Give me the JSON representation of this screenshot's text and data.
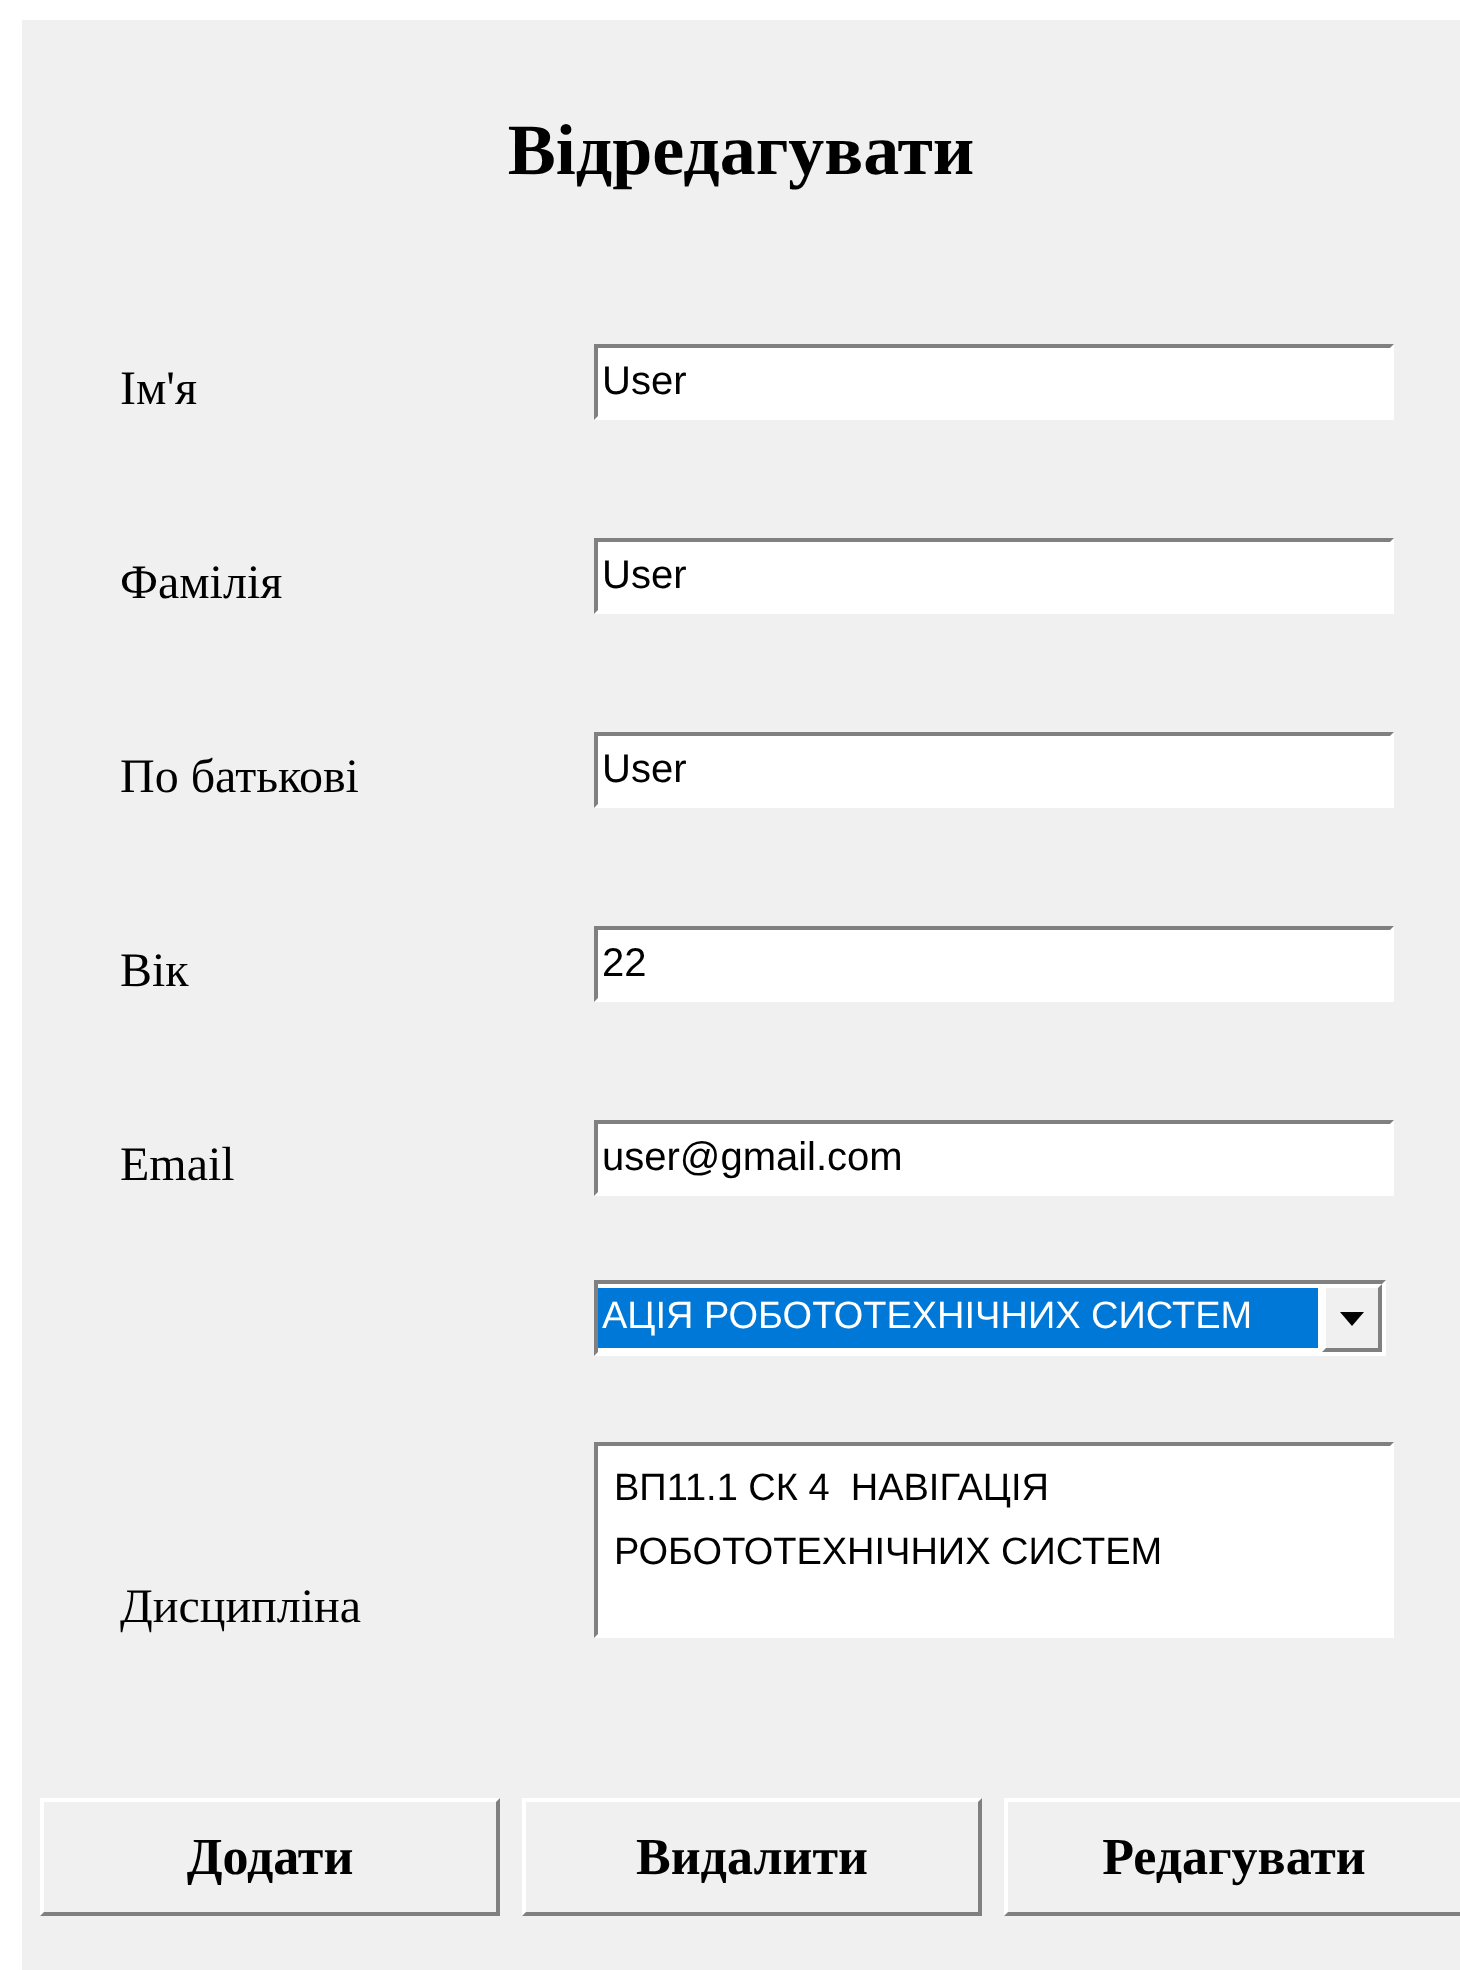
{
  "title": "Відредагувати",
  "fields": [
    {
      "label": "Ім'я",
      "value": "User"
    },
    {
      "label": "Фамілія",
      "value": "User"
    },
    {
      "label": "По батькові",
      "value": "User"
    },
    {
      "label": "Вік",
      "value": "22"
    },
    {
      "label": "Email",
      "value": "user@gmail.com"
    }
  ],
  "discipline": {
    "label": "Дисципліна",
    "dropdown": {
      "value": "АЦІЯ РОБОТОТЕХНІЧНИХ СИСТЕМ",
      "selected": true
    },
    "text": "ВП11.1 СК 4  НАВІГАЦІЯ РОБОТОТЕХНІЧНИХ СИСТЕМ"
  },
  "buttons": [
    "Додати",
    "Видалити",
    "Редагувати"
  ]
}
